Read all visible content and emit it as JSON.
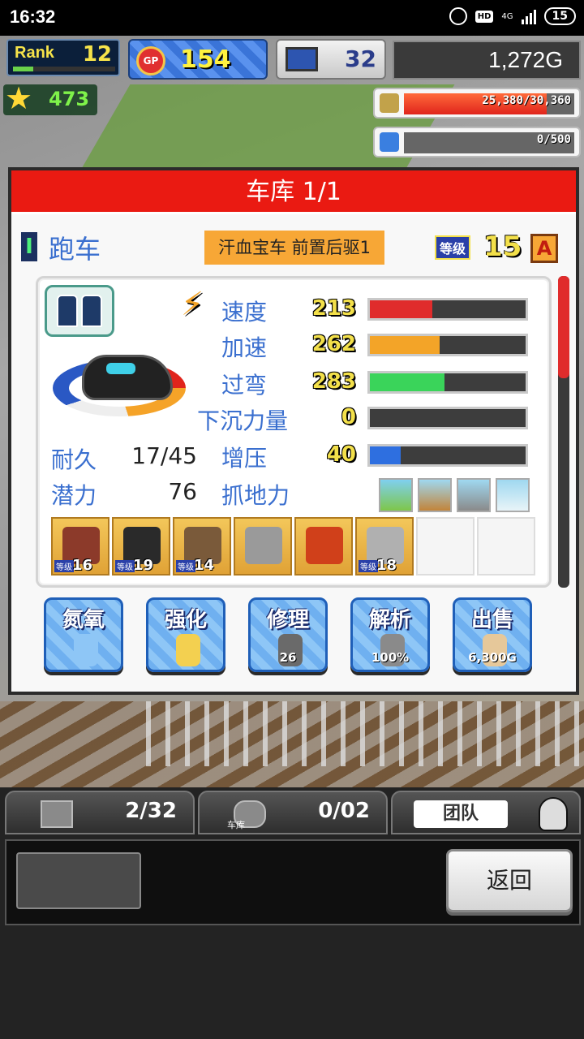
{
  "status_bar": {
    "time": "16:32",
    "hd": "HD",
    "network": "4G",
    "battery": "15"
  },
  "hud": {
    "rank_label": "Rank",
    "rank_value": "12",
    "rank_progress": 0.2,
    "gp_icon": "GP",
    "gp_value": "154",
    "pc_value": "32",
    "money": "1,272G",
    "star_value": "473",
    "fuel_text": "25,380/30,360",
    "fuel_ratio": 0.836,
    "nitro_text": "0/500",
    "nitro_ratio": 0
  },
  "panel": {
    "title": "车库 1/1",
    "class_roman": "I",
    "class_name": "跑车",
    "car_name": "汗血宝车 前置后驱1",
    "level_label": "等级",
    "level_value": "15",
    "grade": "A",
    "bolt_icon": "⚡",
    "stats": [
      {
        "name": "速度",
        "value": "213",
        "ratio": 0.4,
        "color": "#e02c2c"
      },
      {
        "name": "加速",
        "value": "262",
        "ratio": 0.45,
        "color": "#f3a428"
      },
      {
        "name": "过弯",
        "value": "283",
        "ratio": 0.48,
        "color": "#3ad45a"
      },
      {
        "name": "下沉力量",
        "value": "0",
        "ratio": 0,
        "color": "#3a6fcf"
      },
      {
        "name": "增压",
        "value": "40",
        "ratio": 0.2,
        "color": "#2e6fe0"
      }
    ],
    "durability_label": "耐久",
    "durability_value": "17/45",
    "potential_label": "潜力",
    "potential_value": "76",
    "grip_label": "抓地力",
    "parts": [
      {
        "level_label": "等级",
        "level": "16",
        "icon": "engine-icon",
        "color": "#8c3a2a"
      },
      {
        "level_label": "等级",
        "level": "19",
        "icon": "tire-icon",
        "color": "#2a2a2a"
      },
      {
        "level_label": "等级",
        "level": "14",
        "icon": "brake-icon",
        "color": "#7a5a3a"
      },
      {
        "level_label": "",
        "level": "",
        "icon": "muffler-icon",
        "color": "#9a9a9a"
      },
      {
        "level_label": "",
        "level": "",
        "icon": "oil-icon",
        "color": "#d0401a"
      },
      {
        "level_label": "等级",
        "level": "18",
        "icon": "suspension-icon",
        "color": "#b0b0b0"
      }
    ],
    "actions": [
      {
        "label": "氮氧",
        "icon": "nitro-bottle-icon",
        "sub": ""
      },
      {
        "label": "强化",
        "icon": "egg-icon",
        "sub": ""
      },
      {
        "label": "修理",
        "icon": "repair-icon",
        "sub": "26"
      },
      {
        "label": "解析",
        "icon": "analyze-icon",
        "sub": "100%"
      },
      {
        "label": "出售",
        "icon": "money-bag-icon",
        "sub": "6,300G"
      }
    ]
  },
  "bottom": {
    "tab1_count": "2/32",
    "tab2_count": "0/02",
    "tab2_label": "车库",
    "tab3_label": "团队",
    "back_label": "返回"
  },
  "colors": {
    "title_red": "#ea1a12",
    "accent_blue": "#3a6fcf",
    "name_orange": "#f7a736"
  }
}
